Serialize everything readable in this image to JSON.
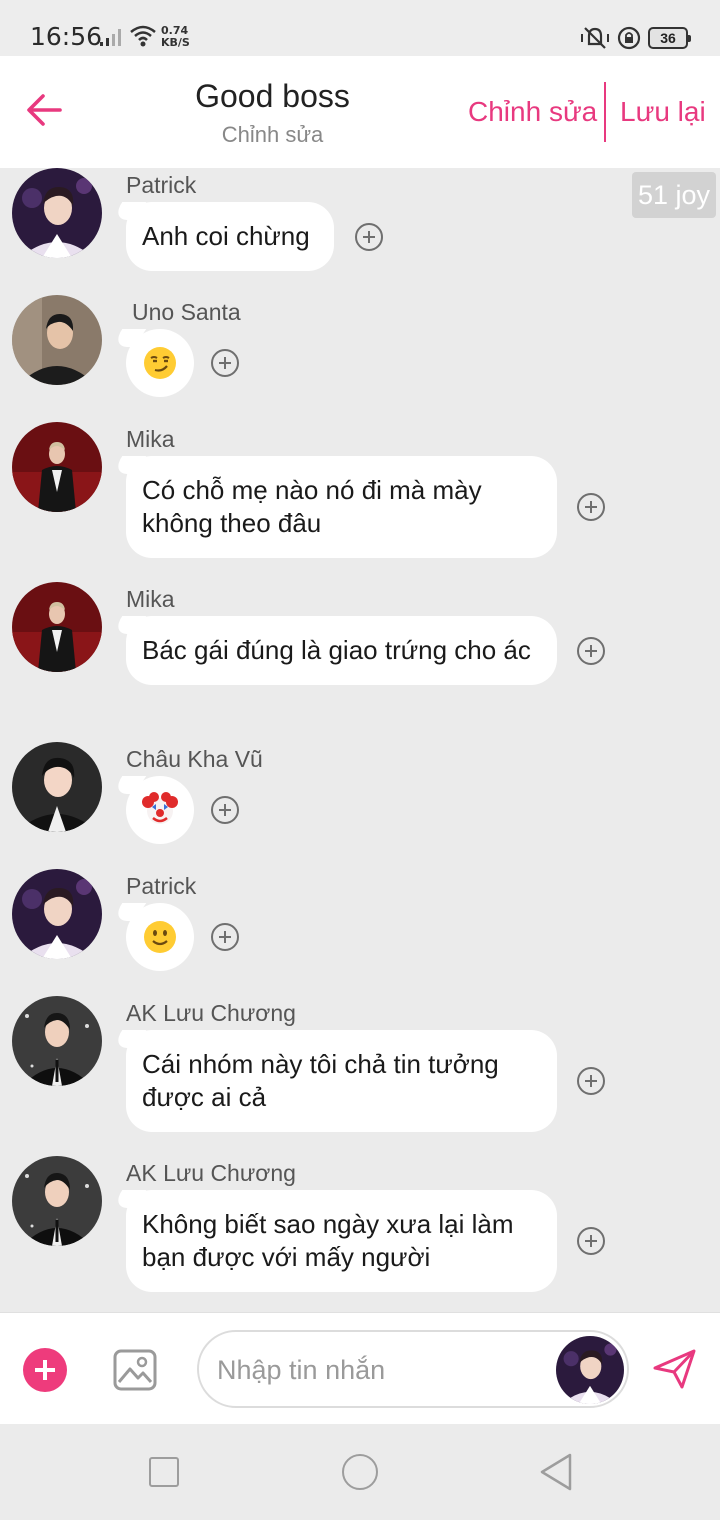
{
  "status_bar": {
    "time": "16:56",
    "net_speed_value": "0.74",
    "net_speed_unit": "KB/S",
    "battery": "36"
  },
  "header": {
    "title": "Good boss",
    "subtitle": "Chỉnh sửa",
    "edit_label": "Chỉnh sửa",
    "save_label": "Lưu lại",
    "accent_color": "#e8397f"
  },
  "joy_badge": "51 joy",
  "messages": [
    {
      "sender": "Patrick",
      "text": "Anh coi chừng",
      "avatar": "patrick"
    },
    {
      "sender": "Uno Santa",
      "emoji": "smirking-face",
      "avatar": "uno-santa"
    },
    {
      "sender": "Mika",
      "text": "Có chỗ mẹ nào nó đi mà mày không theo đâu",
      "avatar": "mika"
    },
    {
      "sender": "Mika",
      "text": "Bác gái đúng là giao trứng cho ác",
      "avatar": "mika"
    },
    {
      "sender": "Châu Kha Vũ",
      "emoji": "clown-face",
      "avatar": "chau-kha-vu"
    },
    {
      "sender": "Patrick",
      "emoji": "slightly-smiling-face",
      "avatar": "patrick"
    },
    {
      "sender": "AK Lưu Chương",
      "text": "Cái nhóm này tôi chả tin tưởng được ai cả",
      "avatar": "ak-luu-chuong"
    },
    {
      "sender": "AK Lưu Chương",
      "text": "Không biết sao ngày xưa lại làm bạn được với mấy người",
      "avatar": "ak-luu-chuong"
    }
  ],
  "composer": {
    "placeholder": "Nhập tin nhắn",
    "value": ""
  },
  "icons": {
    "back": "arrow-left-icon",
    "add": "plus-icon",
    "image": "image-icon",
    "send": "send-icon",
    "reaction": "add-reaction-icon"
  }
}
